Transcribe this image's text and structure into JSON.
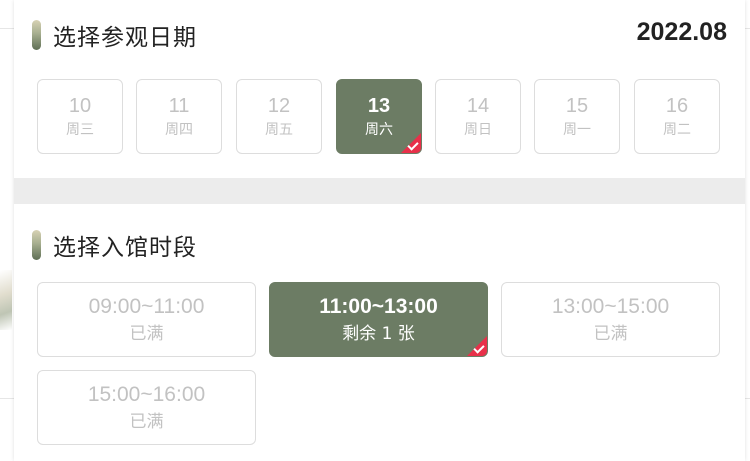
{
  "date_section": {
    "title": "选择参观日期",
    "month": "2022.08",
    "dates": [
      {
        "day": "10",
        "weekday": "周三",
        "selected": false
      },
      {
        "day": "11",
        "weekday": "周四",
        "selected": false
      },
      {
        "day": "12",
        "weekday": "周五",
        "selected": false
      },
      {
        "day": "13",
        "weekday": "周六",
        "selected": true
      },
      {
        "day": "14",
        "weekday": "周日",
        "selected": false
      },
      {
        "day": "15",
        "weekday": "周一",
        "selected": false
      },
      {
        "day": "16",
        "weekday": "周二",
        "selected": false
      }
    ]
  },
  "time_section": {
    "title": "选择入馆时段",
    "slots": [
      {
        "time": "09:00~11:00",
        "status": "已满",
        "selected": false
      },
      {
        "time": "11:00~13:00",
        "status": "剩余 1 张",
        "selected": true
      },
      {
        "time": "13:00~15:00",
        "status": "已满",
        "selected": false
      },
      {
        "time": "15:00~16:00",
        "status": "已满",
        "selected": false
      }
    ]
  },
  "colors": {
    "accent": "#6c7c64",
    "check_corner": "#e8304a",
    "disabled_text": "#c2c2c2",
    "divider": "#ececec"
  },
  "icons": {
    "section_marker": "vertical-bar-icon",
    "selected_marker": "check-corner-icon"
  }
}
